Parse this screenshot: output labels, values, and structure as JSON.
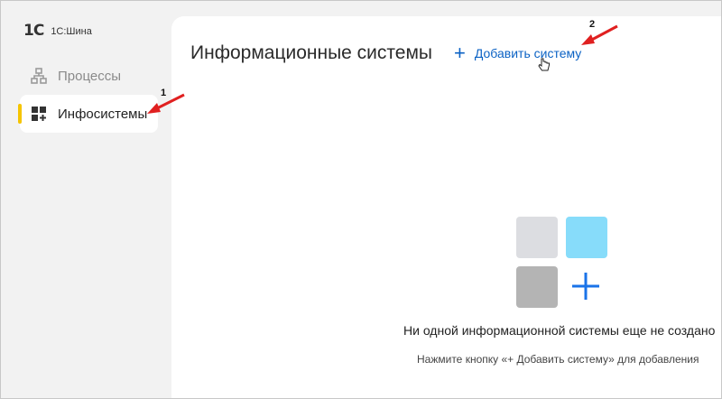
{
  "app": {
    "logo_mark": "1С",
    "product": "1С:Шина"
  },
  "sidebar": {
    "items": [
      {
        "label": "Процессы",
        "icon": "hierarchy-icon",
        "active": false
      },
      {
        "label": "Инфосистемы",
        "icon": "grid-add-icon",
        "active": true
      }
    ]
  },
  "main": {
    "title": "Информационные системы",
    "add_button": {
      "label": "Добавить систему",
      "icon": "plus-icon"
    },
    "empty_state": {
      "title": "Ни одной информационной системы еще не создано",
      "hint": "Нажмите кнопку «+ Добавить систему» для добавления"
    }
  },
  "annotations": {
    "callout_1": "1",
    "callout_2": "2"
  },
  "colors": {
    "accent_yellow": "#f5c400",
    "link_blue": "#0b62c4",
    "arrow_red": "#e02020",
    "tile_cyan": "#87dcfa"
  }
}
